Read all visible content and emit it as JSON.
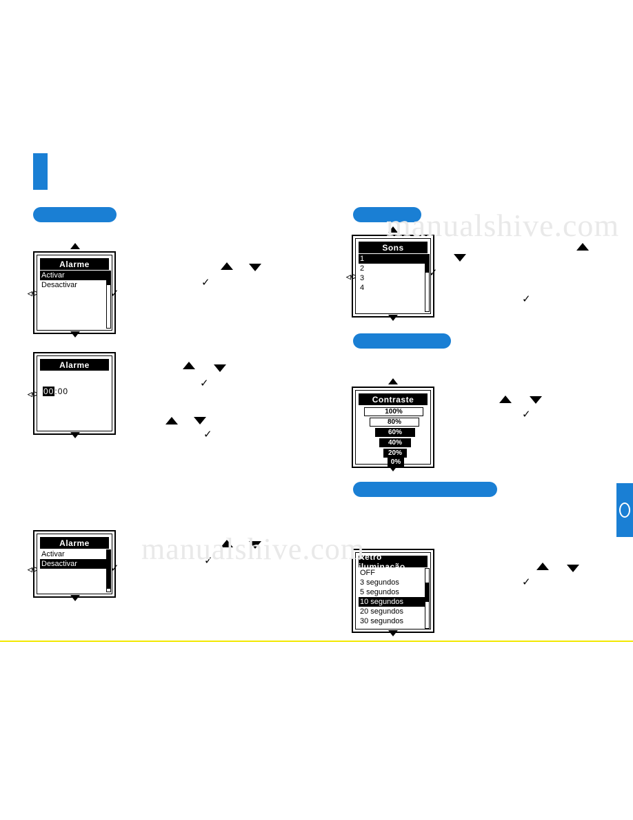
{
  "meta": {
    "watermark_line1": "manualshive.com",
    "watermark_line2": "manualshive.com"
  },
  "chips": {
    "alarm": "",
    "sounds": "",
    "contrast": "",
    "backlight": ""
  },
  "screens": {
    "alarm_activate": {
      "title": "Alarme",
      "items": [
        {
          "label": "Activar",
          "selected": true
        },
        {
          "label": "Desactivar",
          "selected": false
        }
      ]
    },
    "alarm_time": {
      "title": "Alarme",
      "hours": "00",
      "separator": ":",
      "minutes": "00"
    },
    "alarm_deactivate": {
      "title": "Alarme",
      "items": [
        {
          "label": "Activar",
          "selected": false
        },
        {
          "label": "Desactivar",
          "selected": true
        }
      ]
    },
    "sounds": {
      "title": "Sons",
      "items": [
        {
          "label": "1",
          "selected": true
        },
        {
          "label": "2",
          "selected": false
        },
        {
          "label": "3",
          "selected": false
        },
        {
          "label": "4",
          "selected": false
        }
      ]
    },
    "contrast": {
      "title": "Contraste",
      "levels": [
        {
          "label": "100%",
          "selected": false
        },
        {
          "label": "80%",
          "selected": false
        },
        {
          "label": "60%",
          "selected": true
        },
        {
          "label": "40%",
          "selected": true
        },
        {
          "label": "20%",
          "selected": true
        },
        {
          "label": "0%",
          "selected": true
        }
      ]
    },
    "backlight": {
      "title": "Retro iluminação",
      "items": [
        {
          "label": "OFF",
          "selected": false
        },
        {
          "label": "3 segundos",
          "selected": false
        },
        {
          "label": "5 segundos",
          "selected": false
        },
        {
          "label": "10 segundos",
          "selected": true
        },
        {
          "label": "20 segundos",
          "selected": false
        },
        {
          "label": "30 segundos",
          "selected": false
        }
      ]
    }
  },
  "glyphs": {
    "check": "✓",
    "c_mark": "◁C"
  },
  "colors": {
    "accent": "#1a7fd4",
    "rule": "#f2e800",
    "ink": "#000000"
  }
}
